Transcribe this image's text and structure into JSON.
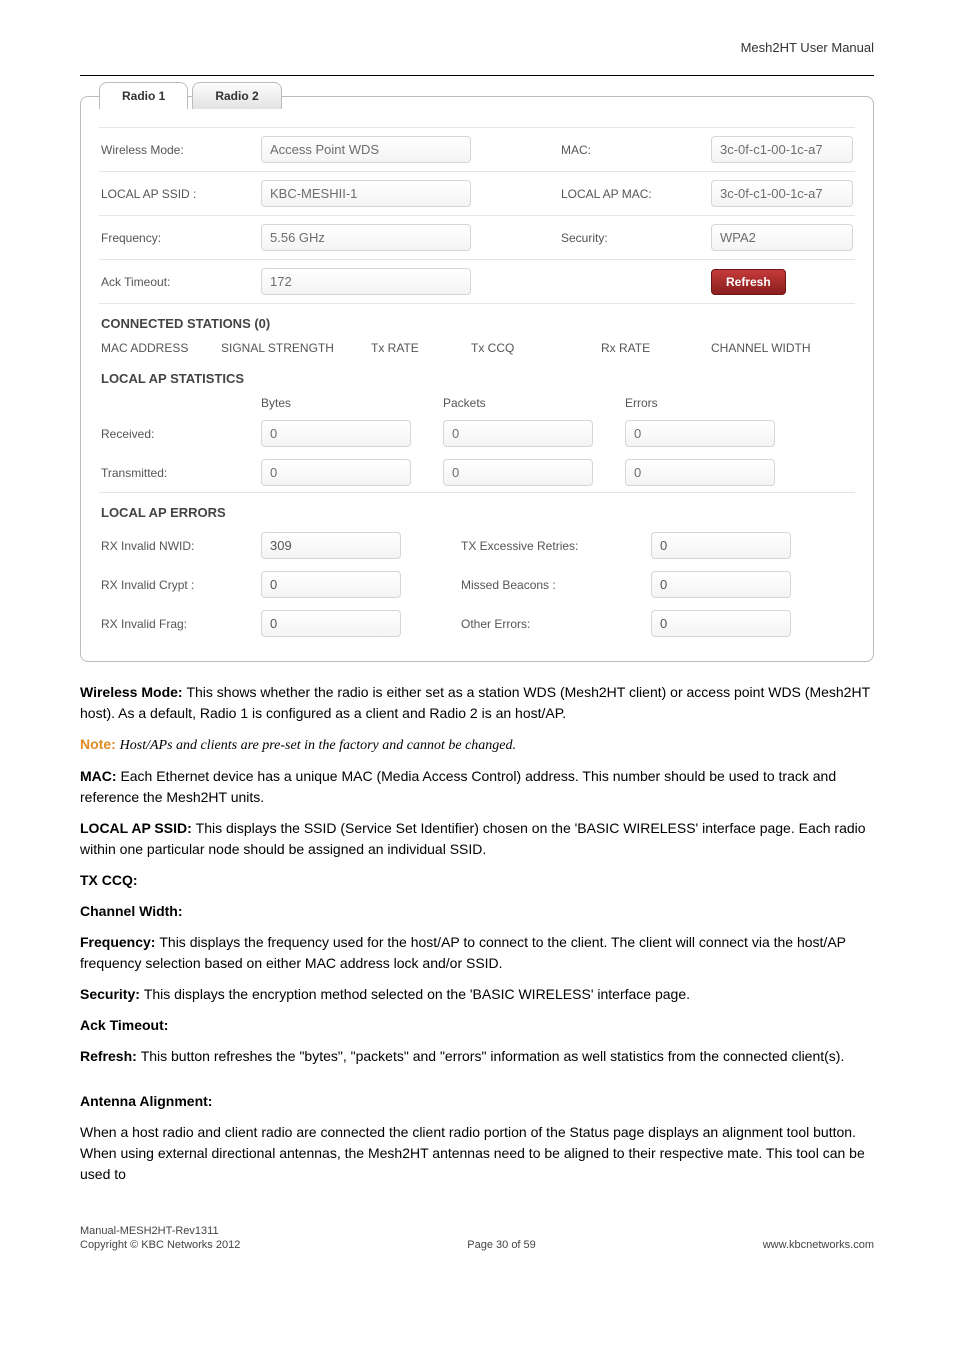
{
  "page_header": "Mesh2HT User Manual",
  "tabs": [
    "Radio 1",
    "Radio 2"
  ],
  "info": {
    "wireless_mode": {
      "label": "Wireless Mode:",
      "value": "Access Point WDS"
    },
    "mac": {
      "label": "MAC:",
      "value": "3c-0f-c1-00-1c-a7"
    },
    "local_ap_ssid": {
      "label": "LOCAL AP SSID :",
      "value": "KBC-MESHII-1"
    },
    "local_ap_mac": {
      "label": "LOCAL AP MAC:",
      "value": "3c-0f-c1-00-1c-a7"
    },
    "frequency": {
      "label": "Frequency:",
      "value": "5.56 GHz"
    },
    "security": {
      "label": "Security:",
      "value": "WPA2"
    },
    "ack_timeout": {
      "label": "Ack Timeout:",
      "value": "172"
    },
    "refresh": "Refresh"
  },
  "sections": {
    "connected_stations": "CONNECTED STATIONS  (0)",
    "local_ap_statistics": "LOCAL AP STATISTICS",
    "local_ap_errors": "LOCAL AP ERRORS"
  },
  "conn_headers": {
    "mac_address": "MAC ADDRESS",
    "signal_strength": "SIGNAL STRENGTH",
    "tx_rate": "Tx RATE",
    "tx_ccq": "Tx CCQ",
    "rx_rate": "Rx RATE",
    "channel_width": "CHANNEL WIDTH"
  },
  "stats": {
    "headers": {
      "bytes": "Bytes",
      "packets": "Packets",
      "errors": "Errors"
    },
    "received": {
      "label": "Received:",
      "bytes": "0",
      "packets": "0",
      "errors": "0"
    },
    "transmitted": {
      "label": "Transmitted:",
      "bytes": "0",
      "packets": "0",
      "errors": "0"
    }
  },
  "errors": {
    "rx_invalid_nwid": {
      "label": "RX Invalid NWID:",
      "value": "309"
    },
    "tx_excessive": {
      "label": "TX Excessive Retries:",
      "value": "0"
    },
    "rx_invalid_crypt": {
      "label": "RX Invalid Crypt :",
      "value": "0"
    },
    "missed_beacons": {
      "label": "Missed Beacons :",
      "value": "0"
    },
    "rx_invalid_frag": {
      "label": "RX Invalid Frag:",
      "value": "0"
    },
    "other_errors": {
      "label": "Other Errors:",
      "value": "0"
    }
  },
  "doc": {
    "wm_label": "Wireless Mode: ",
    "wm_text": "This shows whether the radio is either set as a station WDS (Mesh2HT client) or access point WDS (Mesh2HT host). As a default, Radio 1 is configured as a client and Radio 2 is an host/AP.",
    "note_label": "Note: ",
    "note_text": "Host/APs and clients are pre-set in the factory and cannot be changed.",
    "mac_label": "MAC: ",
    "mac_text": "Each Ethernet device has a unique MAC (Media Access Control) address. This number should be used to track and reference the Mesh2HT units.",
    "ssid_label": "LOCAL AP SSID: ",
    "ssid_text": "This displays the SSID (Service Set Identifier) chosen on the 'BASIC WIRELESS' interface page. Each radio within one particular node should be assigned an individual SSID.",
    "ccq": "TX CCQ:",
    "cw": "Channel Width:",
    "freq_label": "Frequency: ",
    "freq_text": "This displays the frequency used for the host/AP to connect to the client. The client will connect via the host/AP frequency selection based on either MAC address lock and/or SSID.",
    "sec_label": "Security: ",
    "sec_text": "This displays the encryption method selected on the 'BASIC WIRELESS' interface page.",
    "ack": "Ack Timeout:",
    "ref_label": "Refresh: ",
    "ref_text": "This button refreshes the \"bytes\", \"packets\" and \"errors\" information as well statistics from the connected client(s).",
    "align_label": "Antenna Alignment:",
    "align_text": "When a host radio and client radio are connected the client radio portion of the Status page displays an alignment tool button. When using external directional antennas, the Mesh2HT antennas need to be aligned to their respective mate. This tool can be used to"
  },
  "footer": {
    "l1": "Manual-MESH2HT-Rev1311",
    "l2a": "Copyright © KBC Networks 2012",
    "l2b": "Page 30 of 59",
    "l2c": "www.kbcnetworks.com"
  }
}
